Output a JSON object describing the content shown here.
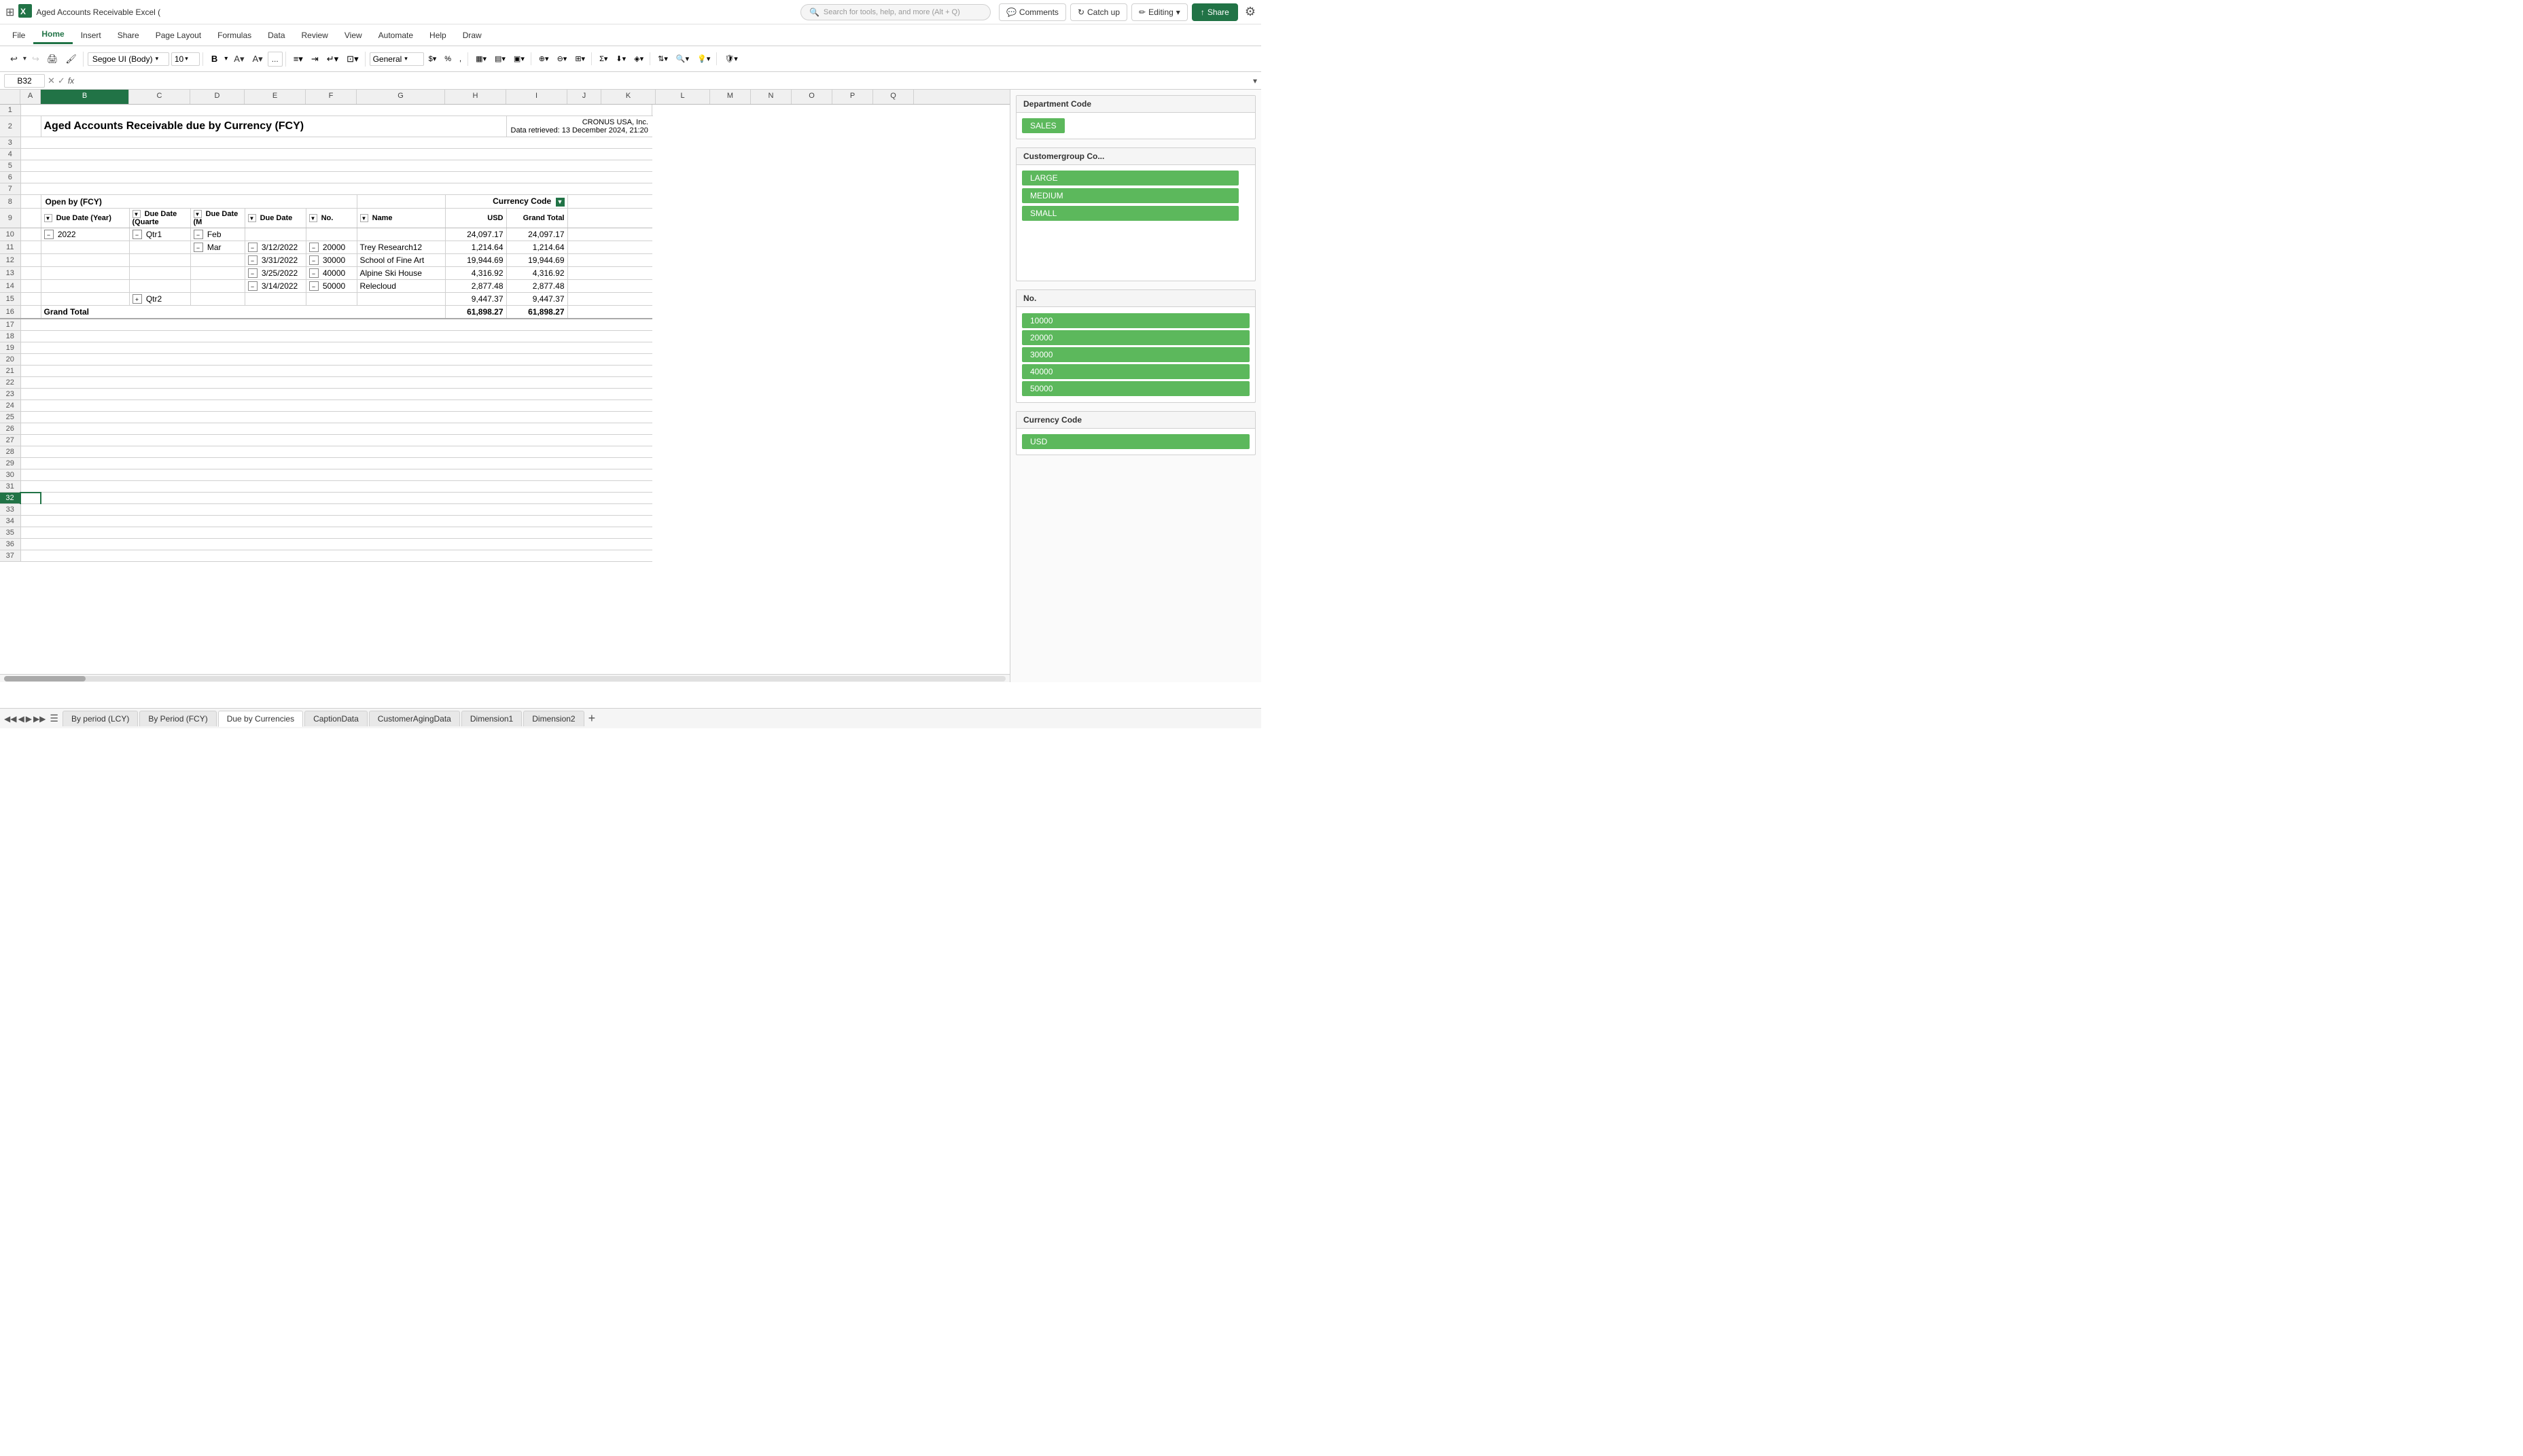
{
  "app": {
    "title": "Aged Accounts Receivable Excel (",
    "icon_color": "#217346"
  },
  "search": {
    "placeholder": "Search for tools, help, and more (Alt + Q)"
  },
  "ribbon": {
    "tabs": [
      "File",
      "Home",
      "Insert",
      "Share",
      "Page Layout",
      "Formulas",
      "Data",
      "Review",
      "View",
      "Automate",
      "Help",
      "Draw"
    ],
    "active_tab": "Home"
  },
  "top_actions": {
    "comments_label": "Comments",
    "catchup_label": "Catch up",
    "editing_label": "Editing",
    "share_label": "Share"
  },
  "toolbar": {
    "font_name": "Segoe UI (Body)",
    "font_size": "10",
    "format": "General",
    "bold": "B",
    "more_btn": "..."
  },
  "formula_bar": {
    "cell_ref": "B32",
    "formula": ""
  },
  "report": {
    "title": "Aged Accounts Receivable due by Currency (FCY)",
    "company": "CRONUS USA, Inc.",
    "data_retrieved": "Data retrieved: 13 December 2024, 21:20"
  },
  "pivot_table": {
    "header_label": "Open by (FCY)",
    "currency_code_label": "Currency Code",
    "columns": {
      "due_date_year": "Due Date (Year)",
      "due_date_quarter": "Due Date (Quarte",
      "due_date_month": "Due Date (M",
      "due_date": "Due Date",
      "no": "No.",
      "name": "Name",
      "usd": "USD",
      "grand_total": "Grand Total"
    },
    "rows": [
      {
        "year": "2022",
        "quarter": "Qtr1",
        "month": "Feb",
        "date": "",
        "no": "",
        "name": "",
        "usd": "24,097.17",
        "grand_total": "24,097.17"
      },
      {
        "year": "",
        "quarter": "",
        "month": "Mar",
        "date": "3/12/2022",
        "no": "20000",
        "name": "Trey Research12",
        "usd": "1,214.64",
        "grand_total": "1,214.64"
      },
      {
        "year": "",
        "quarter": "",
        "month": "",
        "date": "3/31/2022",
        "no": "30000",
        "name": "School of Fine Art",
        "usd": "19,944.69",
        "grand_total": "19,944.69"
      },
      {
        "year": "",
        "quarter": "",
        "month": "",
        "date": "3/25/2022",
        "no": "40000",
        "name": "Alpine Ski House",
        "usd": "4,316.92",
        "grand_total": "4,316.92"
      },
      {
        "year": "",
        "quarter": "",
        "month": "",
        "date": "3/14/2022",
        "no": "50000",
        "name": "Relecloud",
        "usd": "2,877.48",
        "grand_total": "2,877.48"
      },
      {
        "year": "",
        "quarter": "Qtr2",
        "month": "",
        "date": "",
        "no": "",
        "name": "",
        "usd": "9,447.37",
        "grand_total": "9,447.37"
      }
    ],
    "grand_total_label": "Grand Total",
    "grand_total_usd": "61,898.27",
    "grand_total_value": "61,898.27"
  },
  "filter_panel": {
    "dept_code_label": "Department Code",
    "dept_values": [
      "SALES"
    ],
    "customer_group_label": "Customergroup Co...",
    "customer_group_values": [
      "LARGE",
      "MEDIUM",
      "SMALL"
    ],
    "no_label": "No.",
    "no_values": [
      "10000",
      "20000",
      "30000",
      "40000",
      "50000"
    ],
    "currency_code_label": "Currency Code",
    "currency_code_values": [
      "USD"
    ]
  },
  "sheet_tabs": [
    {
      "label": "By period (LCY)",
      "active": false
    },
    {
      "label": "By Period (FCY)",
      "active": false
    },
    {
      "label": "Due by Currencies",
      "active": true
    },
    {
      "label": "CaptionData",
      "active": false
    },
    {
      "label": "CustomerAgingData",
      "active": false
    },
    {
      "label": "Dimension1",
      "active": false
    },
    {
      "label": "Dimension2",
      "active": false
    }
  ],
  "icons": {
    "search": "🔍",
    "settings": "⚙",
    "comments": "💬",
    "catchup": "↻",
    "editing": "✏",
    "share": "↑",
    "undo": "↩",
    "redo": "↪",
    "print": "🖨",
    "bold": "B",
    "italic": "I",
    "underline": "U",
    "filter": "▼",
    "expand": "+",
    "collapse": "−",
    "add": "+",
    "prev": "◀",
    "next": "▶",
    "menu": "☰",
    "cross": "✕",
    "check": "✓"
  }
}
